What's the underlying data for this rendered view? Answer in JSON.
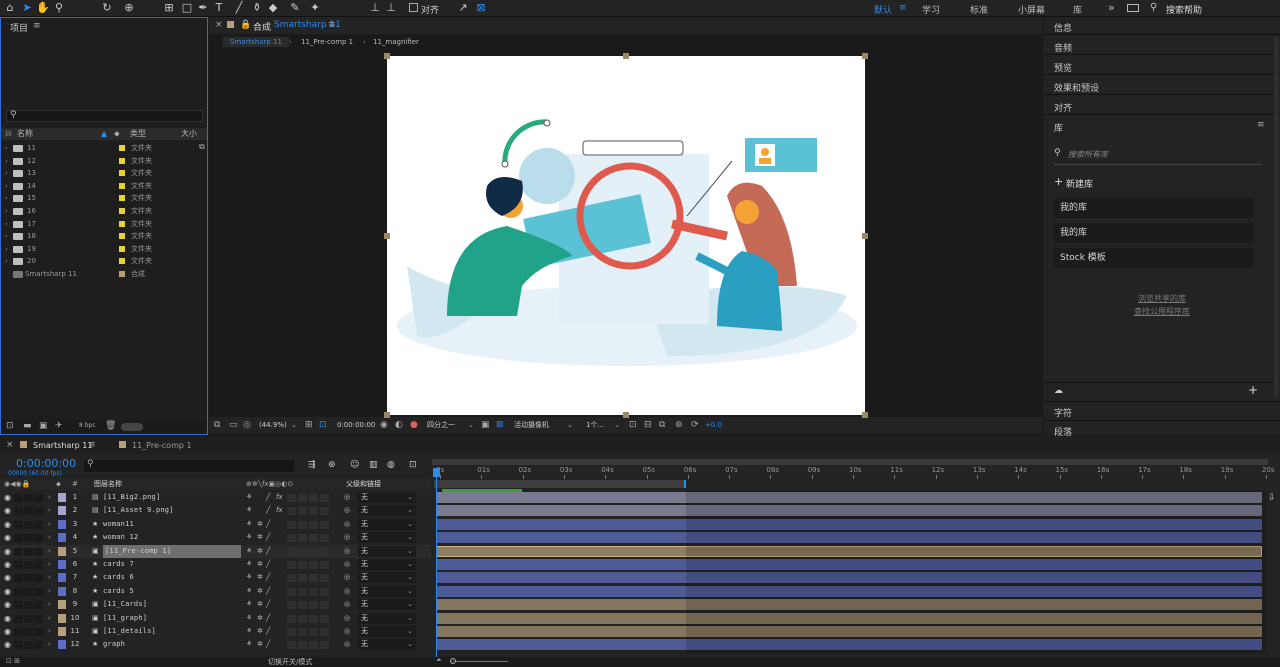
{
  "toolbar": {
    "snap_label": "对齐",
    "workspaces": [
      "默认",
      "学习",
      "标准",
      "小屏幕",
      "库"
    ],
    "search_placeholder": "搜索帮助",
    "accent": "#2d8ceb"
  },
  "project": {
    "title": "项目",
    "columns": [
      "名称",
      "类型",
      "大小"
    ],
    "type_folder": "文件夹",
    "items": [
      {
        "name": "11",
        "type": "文件夹"
      },
      {
        "name": "12",
        "type": "文件夹"
      },
      {
        "name": "13",
        "type": "文件夹"
      },
      {
        "name": "14",
        "type": "文件夹"
      },
      {
        "name": "15",
        "type": "文件夹"
      },
      {
        "name": "16",
        "type": "文件夹"
      },
      {
        "name": "17",
        "type": "文件夹"
      },
      {
        "name": "18",
        "type": "文件夹"
      },
      {
        "name": "19",
        "type": "文件夹"
      },
      {
        "name": "20",
        "type": "文件夹"
      },
      {
        "name": "Smartsharp 11",
        "type": "合成"
      }
    ],
    "bpc": "8 bpc"
  },
  "comp": {
    "tab_prefix": "合成",
    "tab_name": "Smartsharp 11",
    "breadcrumbs": [
      "Smartsharp 11",
      "11_Pre-comp 1",
      "11_magnifier"
    ],
    "zoom": "(44.9%)",
    "time": "0:00:00:00",
    "resolution": "四分之一",
    "camera": "活动摄像机",
    "views": "1个...",
    "exposure": "+0.0"
  },
  "right_panel": {
    "items": [
      "信息",
      "音频",
      "预览",
      "效果和预设",
      "对齐"
    ],
    "library_title": "库",
    "lib_search": "搜索所有库",
    "new_lib": "新建库",
    "libs": [
      "我的库",
      "我的库",
      "Stock 模板"
    ],
    "links": [
      "浏览共享的库",
      "查找公用程序库"
    ],
    "bottom": [
      "字符",
      "段落"
    ]
  },
  "timeline": {
    "tabs": [
      "Smartsharp 11",
      "11_Pre-comp 1"
    ],
    "timecode": "0:00:00:00",
    "fps": "00000 (60.00 fps)",
    "col_layer": "图层名称",
    "col_parent": "父级和链接",
    "parent_none": "无",
    "bottom_label": "切换开关/模式",
    "ruler": [
      "0s",
      "01s",
      "02s",
      "03s",
      "04s",
      "05s",
      "06s",
      "07s",
      "08s",
      "09s",
      "10s",
      "11s",
      "12s",
      "13s",
      "14s",
      "15s",
      "16s",
      "17s",
      "18s",
      "19s",
      "20s"
    ],
    "layers": [
      {
        "n": "1",
        "name": "[11_Big2.png]",
        "color": "#a5a5d3",
        "bar": "#7a7a90",
        "type": "img"
      },
      {
        "n": "2",
        "name": "[11_Asset 9.png]",
        "color": "#a5a5d3",
        "bar": "#7a7a90",
        "type": "img"
      },
      {
        "n": "3",
        "name": "woman11",
        "color": "#5d6ec9",
        "bar": "#4f5b96",
        "type": "shape"
      },
      {
        "n": "4",
        "name": "woman 12",
        "color": "#5d6ec9",
        "bar": "#4f5b96",
        "type": "shape"
      },
      {
        "n": "5",
        "name": "[11_Pre-comp 1]",
        "color": "#b6a07b",
        "bar": "#8e7d5f",
        "type": "comp"
      },
      {
        "n": "6",
        "name": "cards 7",
        "color": "#5d6ec9",
        "bar": "#4f5b96",
        "type": "shape"
      },
      {
        "n": "7",
        "name": "cards 6",
        "color": "#5d6ec9",
        "bar": "#4f5b96",
        "type": "shape"
      },
      {
        "n": "8",
        "name": "cards 5",
        "color": "#5d6ec9",
        "bar": "#4f5b96",
        "type": "shape"
      },
      {
        "n": "9",
        "name": "[11_Cards]",
        "color": "#b6a07b",
        "bar": "#857660",
        "type": "comp"
      },
      {
        "n": "10",
        "name": "[11_graph]",
        "color": "#b6a07b",
        "bar": "#857660",
        "type": "comp"
      },
      {
        "n": "11",
        "name": "[11_details]",
        "color": "#b6a07b",
        "bar": "#857660",
        "type": "comp"
      },
      {
        "n": "12",
        "name": "graph",
        "color": "#5d6ec9",
        "bar": "#4f5b96",
        "type": "shape"
      }
    ]
  }
}
